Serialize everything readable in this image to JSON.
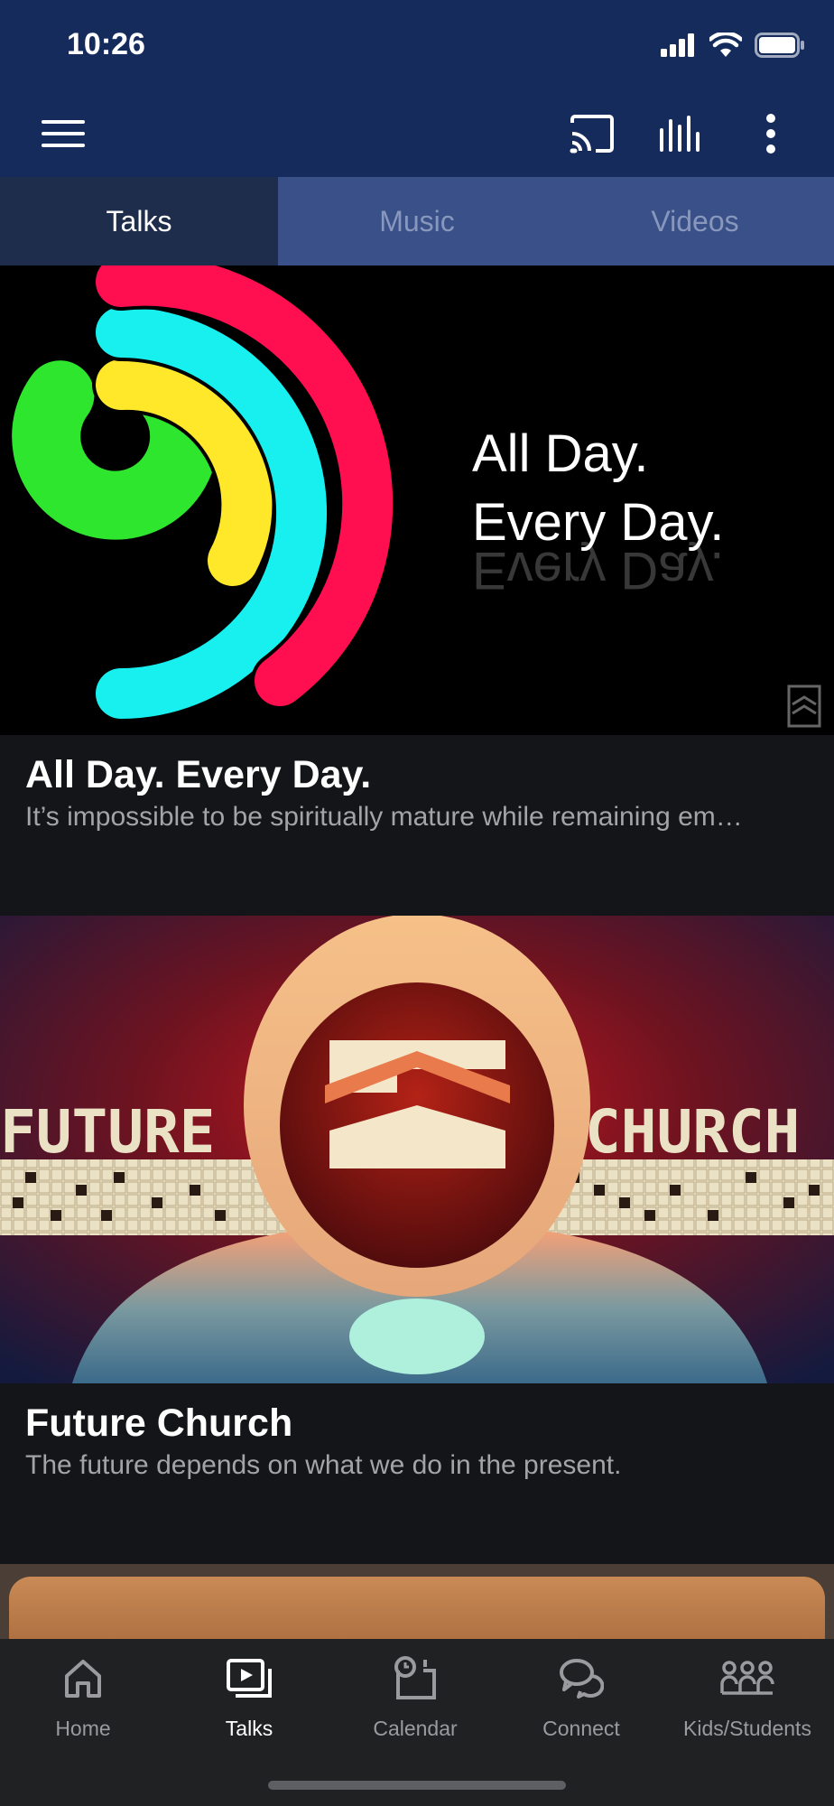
{
  "status_bar": {
    "time": "10:26"
  },
  "toolbar": {
    "menu_icon": "hamburger-menu-icon",
    "cast_icon": "cast-icon",
    "audio_icon": "audio-levels-icon",
    "more_icon": "more-vertical-icon"
  },
  "tabs": [
    {
      "label": "Talks",
      "active": true
    },
    {
      "label": "Music",
      "active": false
    },
    {
      "label": "Videos",
      "active": false
    }
  ],
  "cards": [
    {
      "title": "All Day. Every Day.",
      "subtitle": "It’s impossible to be spiritually mature while remaining em…",
      "artwork_text": [
        "All Day.",
        "Every Day."
      ]
    },
    {
      "title": "Future Church",
      "subtitle": "The future depends on what we do in the present.",
      "artwork_text": [
        "FUTURE",
        "CHURCH"
      ]
    }
  ],
  "bottom_nav": [
    {
      "label": "Home",
      "icon": "home-icon",
      "active": false
    },
    {
      "label": "Talks",
      "icon": "video-library-icon",
      "active": true
    },
    {
      "label": "Calendar",
      "icon": "calendar-icon",
      "active": false
    },
    {
      "label": "Connect",
      "icon": "chat-bubbles-icon",
      "active": false
    },
    {
      "label": "Kids/Students",
      "icon": "group-icon",
      "active": false
    }
  ],
  "colors": {
    "header_bg": "#142b5c",
    "tab_bar_bg": "#3a5088",
    "tab_active_bg": "#1e2d4c",
    "page_bg": "#151618",
    "nav_bg": "#202123"
  }
}
